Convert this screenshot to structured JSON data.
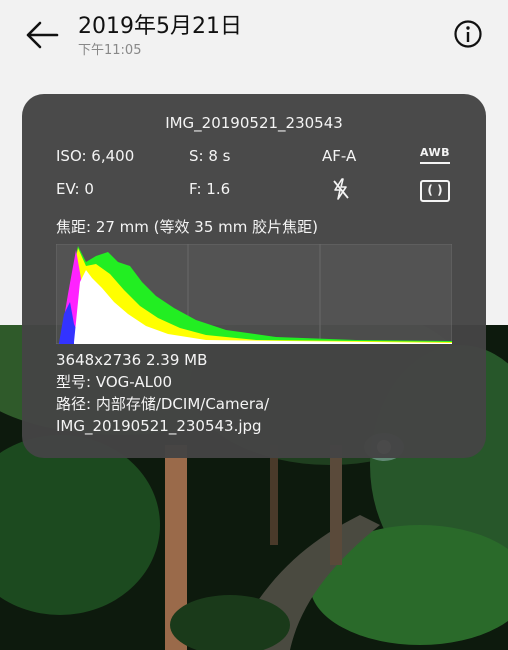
{
  "header": {
    "title": "2019年5月21日",
    "subtitle": "下午11:05",
    "back_icon": "back-arrow-icon",
    "info_icon": "info-icon"
  },
  "details": {
    "filename": "IMG_20190521_230543",
    "iso": "ISO: 6,400",
    "shutter": "S: 8 s",
    "focus_mode": "AF-A",
    "wb": "AWB",
    "ev": "EV: 0",
    "aperture": "F: 1.6",
    "flash_icon": "flash-off-icon",
    "metering_icon": "metering-icon",
    "metering_label": "( )",
    "focal_length": "焦距: 27 mm (等效 35 mm 胶片焦距)",
    "resolution_size": "3648x2736  2.39 MB",
    "model": "型号: VOG-AL00",
    "path_line1": "路径: 内部存储/DCIM/Camera/",
    "path_line2": "IMG_20190521_230543.jpg"
  },
  "colors": {
    "panel": "#444444",
    "hist_green": "#22ee22",
    "hist_yellow": "#ffff00",
    "hist_magenta": "#ff22ff",
    "hist_blue": "#3333ff"
  }
}
